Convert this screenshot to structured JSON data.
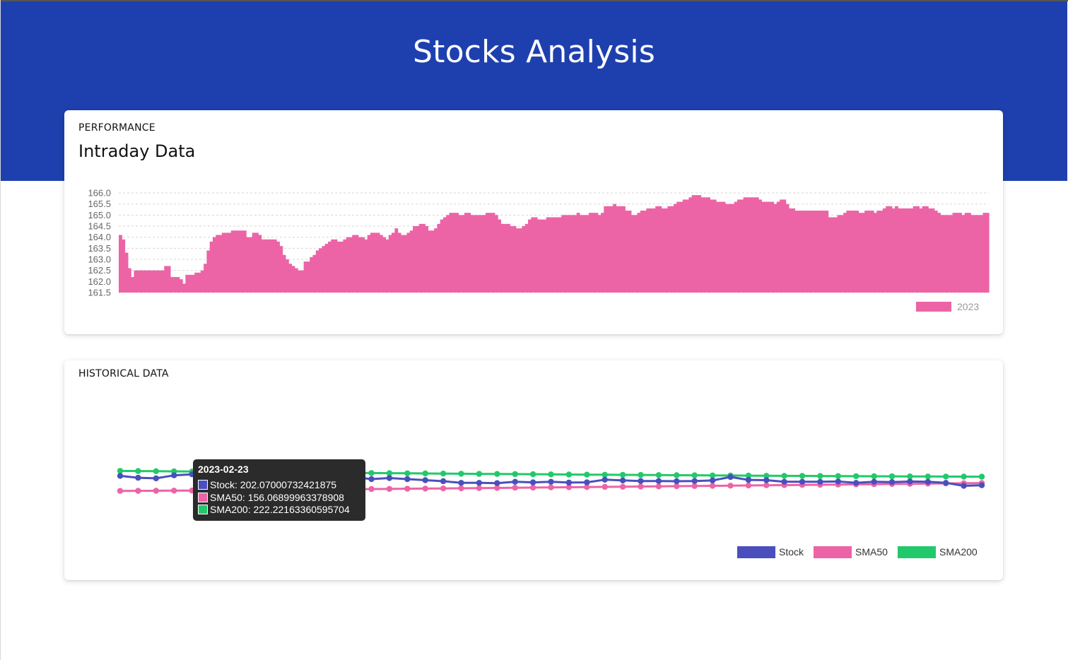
{
  "header": {
    "title": "Stocks Analysis"
  },
  "performance": {
    "eyebrow": "PERFORMANCE",
    "title": "Intraday Data"
  },
  "historical": {
    "eyebrow": "HISTORICAL DATA"
  },
  "colors": {
    "header_bg": "#1e40af",
    "stock": "#4a4fbd",
    "sma50": "#ec64a6",
    "sma200": "#22c96a",
    "intraday": "#ec64a6",
    "tooltip_bg": "#2b2b2b"
  },
  "chart_data": [
    {
      "type": "bar",
      "yticks": [
        "166.0",
        "165.5",
        "165.0",
        "164.5",
        "164.0",
        "163.5",
        "163.0",
        "162.5",
        "162.0",
        "161.5"
      ],
      "ylim": [
        161.5,
        166.0
      ],
      "grid": true,
      "legend_position": "bottom-right",
      "series": [
        {
          "name": "2023",
          "values": [
            164.1,
            163.9,
            163.3,
            162.6,
            162.2,
            162.5,
            162.5,
            162.5,
            162.5,
            162.5,
            162.5,
            162.5,
            162.5,
            162.5,
            162.5,
            162.7,
            162.7,
            162.2,
            162.2,
            162.2,
            162.1,
            161.9,
            162.3,
            162.3,
            162.3,
            162.4,
            162.4,
            162.5,
            162.8,
            163.4,
            163.8,
            164.0,
            164.1,
            164.1,
            164.2,
            164.2,
            164.2,
            164.3,
            164.3,
            164.3,
            164.3,
            164.3,
            164.0,
            164.0,
            164.2,
            164.2,
            164.1,
            163.9,
            163.9,
            163.9,
            163.9,
            163.9,
            163.8,
            163.6,
            163.2,
            163.0,
            162.8,
            162.7,
            162.6,
            162.5,
            162.5,
            162.9,
            162.9,
            163.1,
            163.2,
            163.4,
            163.5,
            163.6,
            163.7,
            163.8,
            163.9,
            163.9,
            163.8,
            163.8,
            163.9,
            164.0,
            164.0,
            164.1,
            164.1,
            164.0,
            164.0,
            163.9,
            164.1,
            164.2,
            164.2,
            164.2,
            164.1,
            164.0,
            163.9,
            164.1,
            164.2,
            164.4,
            164.2,
            164.1,
            164.1,
            164.2,
            164.3,
            164.5,
            164.5,
            164.6,
            164.6,
            164.5,
            164.3,
            164.3,
            164.4,
            164.6,
            164.8,
            164.9,
            165.0,
            165.1,
            165.1,
            165.1,
            165.0,
            165.0,
            165.1,
            165.1,
            165.0,
            165.0,
            165.0,
            165.0,
            165.0,
            165.1,
            165.1,
            165.1,
            165.0,
            164.8,
            164.6,
            164.6,
            164.6,
            164.5,
            164.5,
            164.4,
            164.4,
            164.5,
            164.6,
            164.8,
            164.9,
            164.9,
            164.8,
            164.8,
            164.8,
            164.9,
            164.9,
            164.9,
            164.9,
            164.9,
            165.0,
            165.0,
            165.0,
            165.0,
            165.0,
            165.1,
            165.0,
            165.0,
            165.0,
            165.1,
            165.1,
            165.1,
            165.0,
            165.1,
            165.4,
            165.4,
            165.4,
            165.5,
            165.4,
            165.4,
            165.4,
            165.2,
            165.2,
            165.0,
            165.0,
            165.1,
            165.2,
            165.2,
            165.3,
            165.3,
            165.3,
            165.4,
            165.4,
            165.3,
            165.3,
            165.4,
            165.4,
            165.5,
            165.6,
            165.6,
            165.7,
            165.7,
            165.8,
            165.9,
            165.9,
            165.9,
            165.8,
            165.8,
            165.8,
            165.7,
            165.7,
            165.6,
            165.6,
            165.6,
            165.5,
            165.5,
            165.5,
            165.6,
            165.7,
            165.7,
            165.8,
            165.8,
            165.8,
            165.8,
            165.8,
            165.7,
            165.6,
            165.6,
            165.6,
            165.6,
            165.5,
            165.6,
            165.7,
            165.7,
            165.5,
            165.3,
            165.3,
            165.2,
            165.2,
            165.2,
            165.2,
            165.2,
            165.2,
            165.2,
            165.2,
            165.2,
            165.2,
            165.2,
            164.9,
            164.9,
            164.9,
            165.0,
            165.0,
            165.1,
            165.2,
            165.2,
            165.2,
            165.2,
            165.1,
            165.1,
            165.2,
            165.2,
            165.2,
            165.1,
            165.2,
            165.2,
            165.3,
            165.4,
            165.4,
            165.3,
            165.4,
            165.3,
            165.3,
            165.3,
            165.3,
            165.3,
            165.4,
            165.4,
            165.3,
            165.4,
            165.4,
            165.3,
            165.3,
            165.2,
            165.1,
            165.0,
            165.0,
            165.0,
            165.0,
            165.1,
            165.1,
            165.1,
            165.0,
            165.1,
            165.1,
            165.0,
            165.0,
            165.0,
            165.0,
            165.1,
            165.1
          ]
        }
      ]
    },
    {
      "type": "line",
      "legend_position": "bottom-right",
      "ylim": [
        0,
        500
      ],
      "series": [
        {
          "name": "Stock",
          "values": [
            212,
            205,
            203,
            214,
            218,
            209,
            213,
            205,
            207,
            208,
            205,
            212,
            211,
            208,
            200,
            204,
            200,
            196,
            192,
            186,
            186,
            185,
            190,
            188,
            190,
            187,
            188,
            198,
            195,
            193,
            193,
            192,
            193,
            195,
            208,
            197,
            196,
            190,
            190,
            190,
            191,
            186,
            190,
            189,
            191,
            190,
            186,
            175,
            177
          ]
        },
        {
          "name": "SMA50",
          "values": [
            156.1,
            156.4,
            156.7,
            157.1,
            157.5,
            157.9,
            158.4,
            158.9,
            159.4,
            159.9,
            160.5,
            161.0,
            161.6,
            162.2,
            162.8,
            163.4,
            164.1,
            164.7,
            165.3,
            165.9,
            166.5,
            167.2,
            167.8,
            168.4,
            169.1,
            169.7,
            170.3,
            171.0,
            171.6,
            172.3,
            173.0,
            173.6,
            174.3,
            175.0,
            175.6,
            176.3,
            177.0,
            177.7,
            178.3,
            179.0,
            179.7,
            180.4,
            181.1,
            181.8,
            182.5,
            183.2,
            183.9,
            184.6,
            185.3
          ]
        },
        {
          "name": "SMA200",
          "values": [
            230.5,
            229.9,
            229.4,
            228.8,
            228.2,
            227.6,
            227.1,
            226.5,
            226.0,
            225.4,
            224.9,
            224.3,
            223.8,
            223.2,
            222.7,
            222.2,
            221.6,
            221.1,
            220.6,
            220.1,
            219.6,
            219.1,
            218.6,
            218.1,
            217.6,
            217.2,
            216.7,
            216.2,
            215.8,
            215.4,
            214.9,
            214.5,
            214.1,
            213.7,
            213.3,
            212.9,
            212.5,
            212.2,
            211.8,
            211.5,
            211.2,
            210.8,
            210.5,
            210.2,
            210.0,
            209.7,
            209.4,
            209.2,
            209.0
          ]
        }
      ],
      "tooltip": {
        "index": 9,
        "date": "2023-02-23",
        "lines": [
          "Stock: 202.07000732421875",
          "SMA50: 156.06899963378908",
          "SMA200: 222.22163360595704"
        ]
      }
    }
  ]
}
